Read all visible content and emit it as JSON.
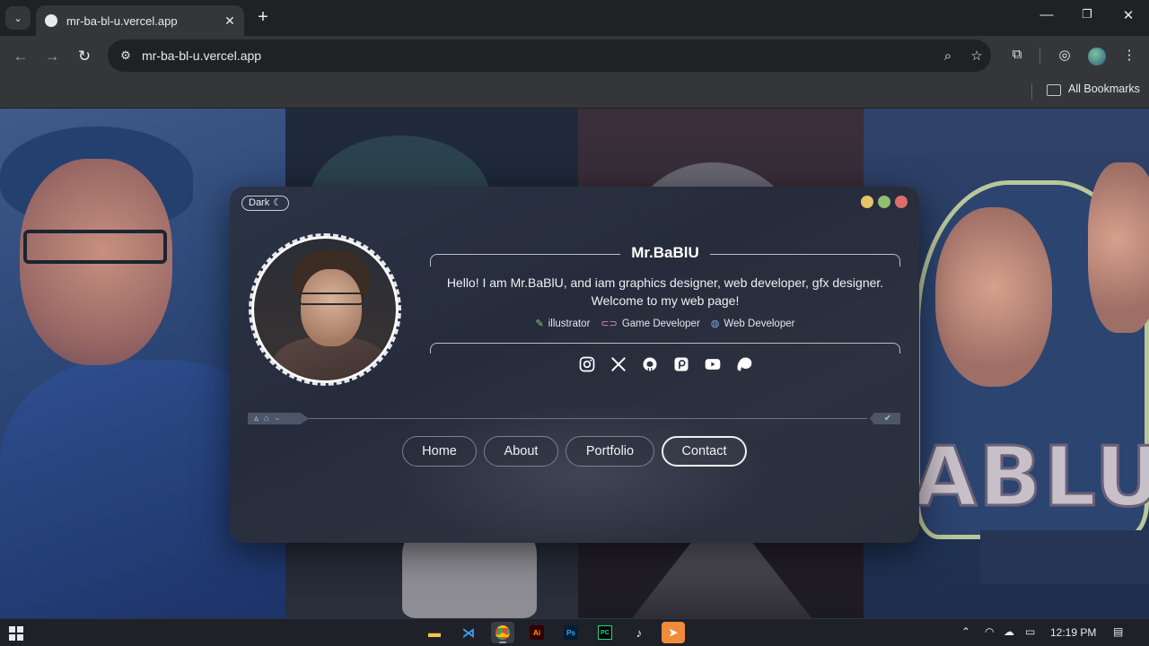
{
  "browser": {
    "tab_title": "mr-ba-bl-u.vercel.app",
    "url": "mr-ba-bl-u.vercel.app",
    "bookmarks_label": "All Bookmarks"
  },
  "card": {
    "theme_label": "Dark",
    "name": "Mr.BaBlU",
    "bio": "Hello! I am Mr.BaBlU, and iam graphics designer, web developer, gfx designer. Welcome to my web page!",
    "tags": [
      {
        "label": "illustrator",
        "icon": "brush-icon",
        "color": "#8ecf6a"
      },
      {
        "label": "Game Developer",
        "icon": "gamepad-icon",
        "color": "#e89ab8"
      },
      {
        "label": "Web Developer",
        "icon": "globe-icon",
        "color": "#7fa6e8"
      }
    ],
    "socials": [
      "instagram-icon",
      "x-icon",
      "github-icon",
      "patreon-icon",
      "youtube-icon",
      "patreon-p-icon"
    ],
    "terminal": {
      "path": "~",
      "status": "✔"
    },
    "nav": [
      "Home",
      "About",
      "Portfolio",
      "Contact"
    ],
    "active_nav": "Contact"
  },
  "background_text": "ABLU",
  "taskbar": {
    "time": "12:19 PM"
  },
  "colors": {
    "card_bg": "#2b3346",
    "dot_yellow": "#e8c468",
    "dot_green": "#8fbf6f",
    "dot_red": "#e06b6b"
  }
}
